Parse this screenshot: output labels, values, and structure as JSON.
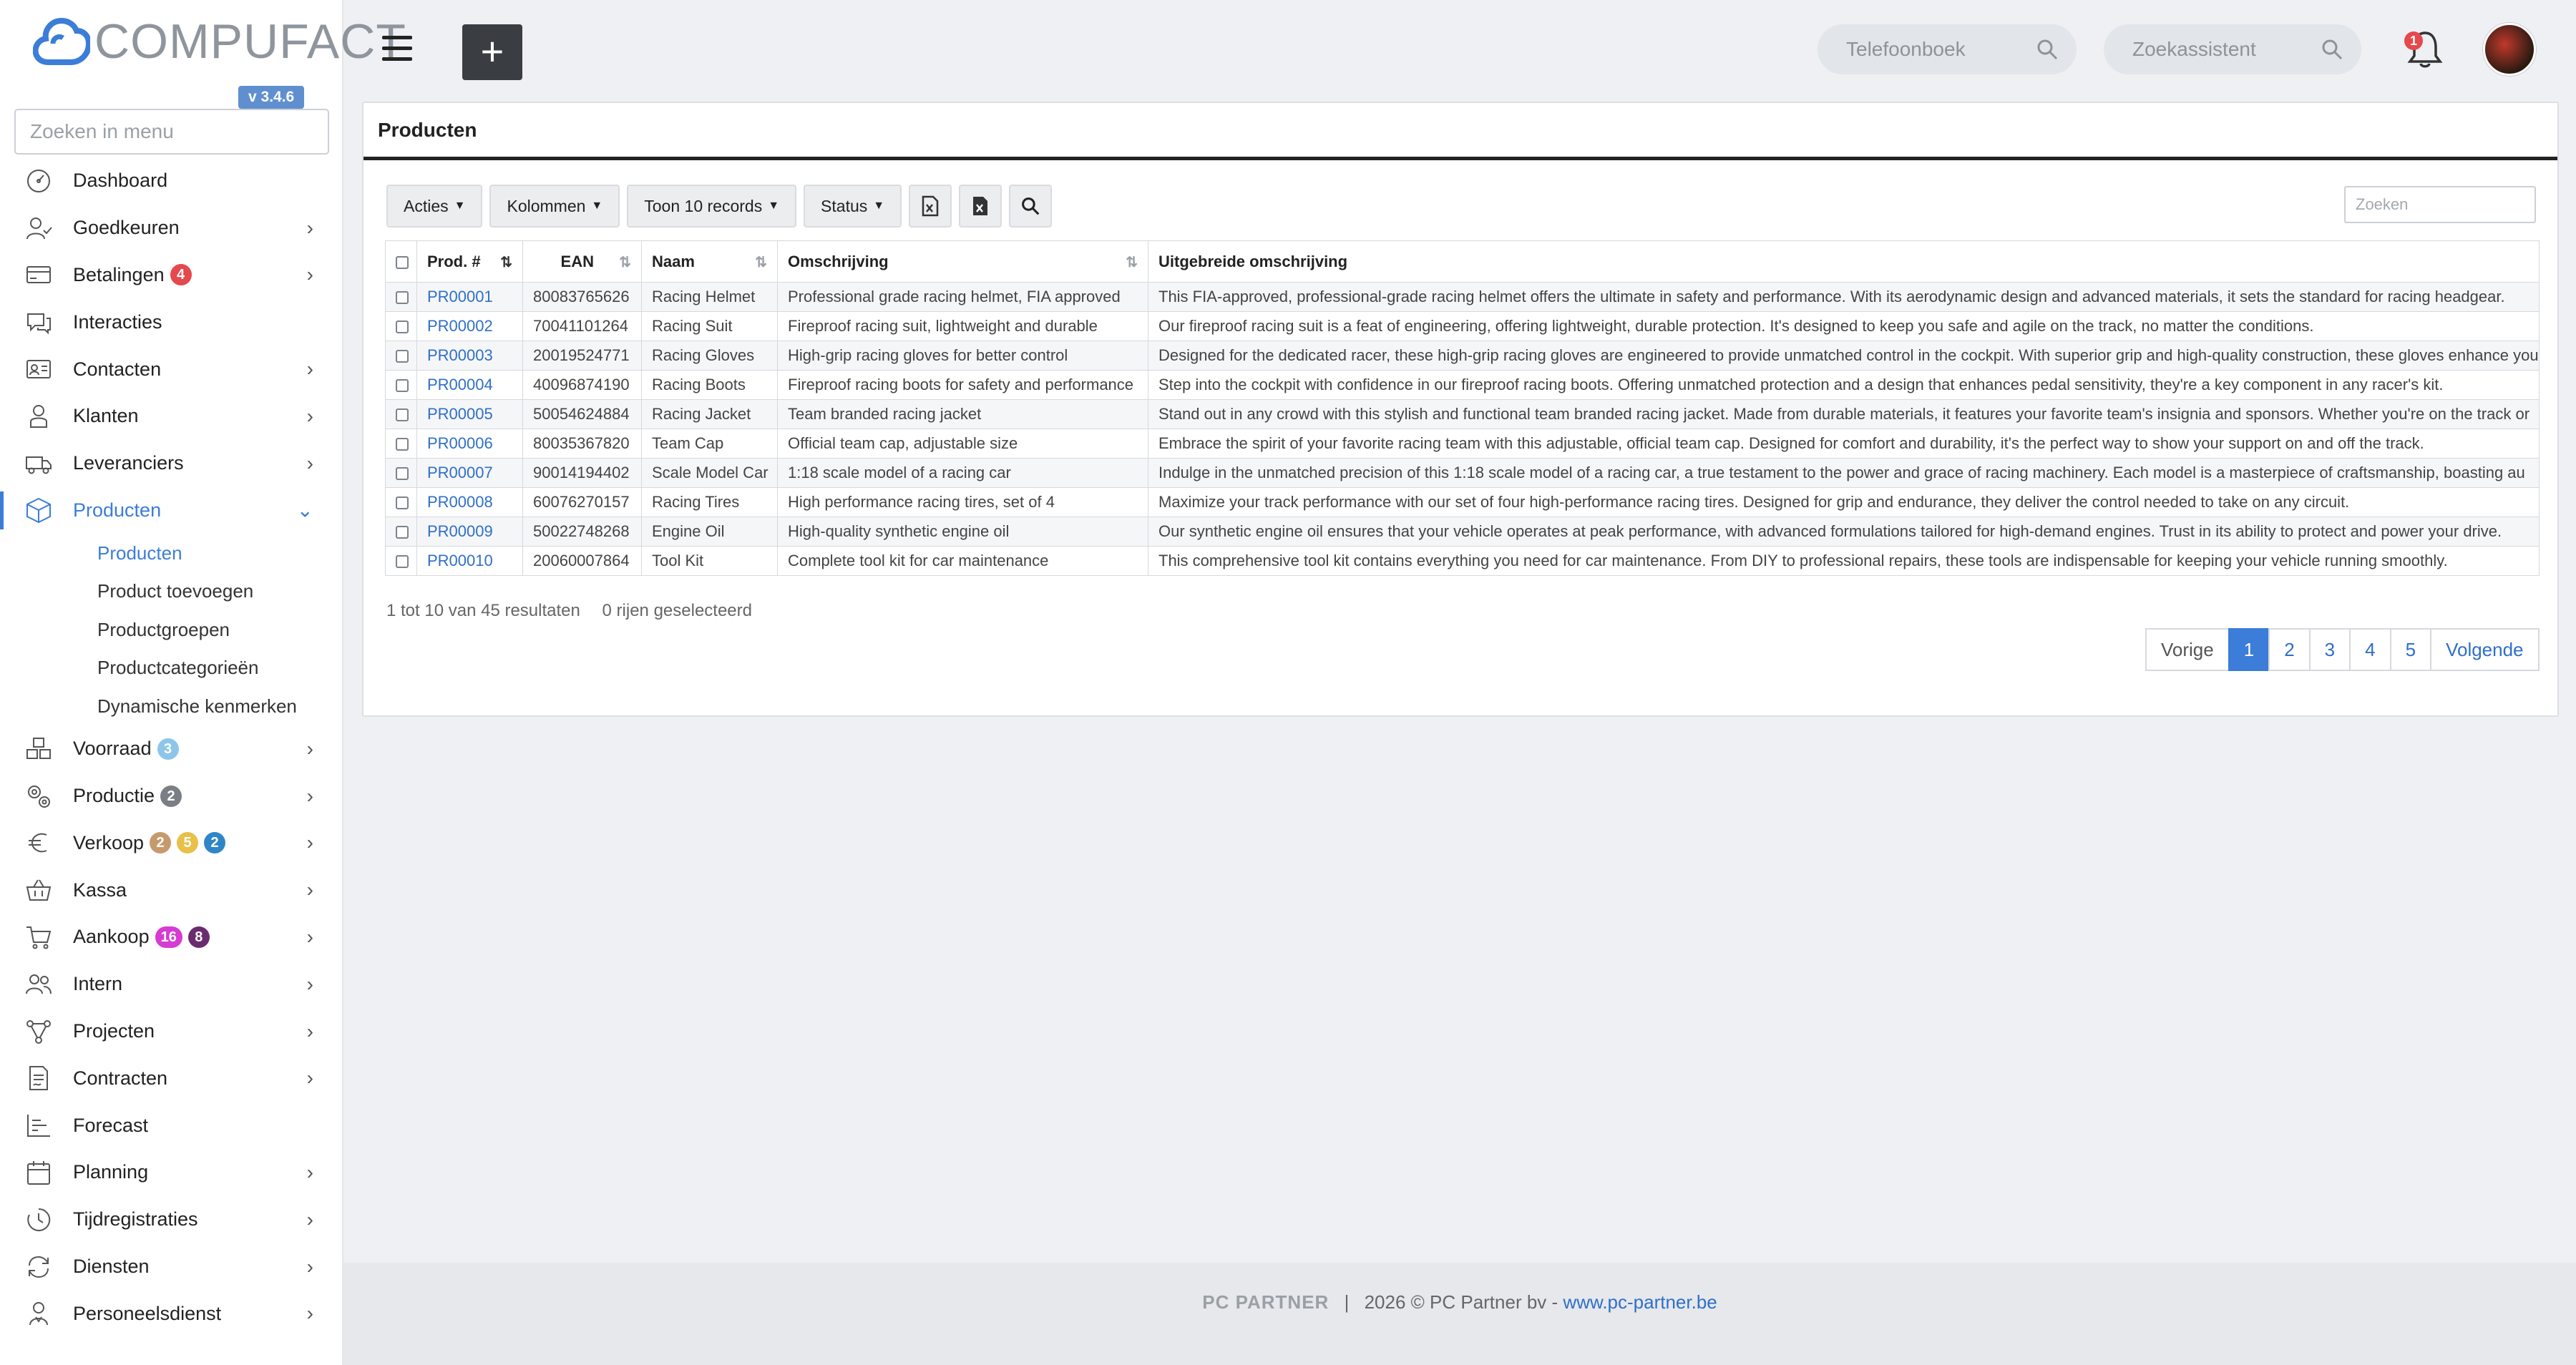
{
  "app": {
    "logo_text": "COMPUFACT",
    "version": "v 3.4.6",
    "menu_search_placeholder": "Zoeken in menu"
  },
  "sidebar": {
    "items": [
      {
        "label": "Dashboard",
        "icon": "dashboard-icon",
        "chevron": false
      },
      {
        "label": "Goedkeuren",
        "icon": "user-check-icon",
        "chevron": true
      },
      {
        "label": "Betalingen",
        "icon": "credit-card-icon",
        "chevron": true,
        "badges": [
          {
            "text": "4",
            "color": "#e5484d"
          }
        ]
      },
      {
        "label": "Interacties",
        "icon": "chat-icon",
        "chevron": false
      },
      {
        "label": "Contacten",
        "icon": "contact-card-icon",
        "chevron": true
      },
      {
        "label": "Klanten",
        "icon": "person-icon",
        "chevron": true
      },
      {
        "label": "Leveranciers",
        "icon": "truck-icon",
        "chevron": true
      },
      {
        "label": "Producten",
        "icon": "box-icon",
        "chevron": true,
        "active": true
      }
    ],
    "sub_items": [
      {
        "label": "Producten",
        "active": true
      },
      {
        "label": "Product toevoegen"
      },
      {
        "label": "Productgroepen"
      },
      {
        "label": "Productcategorieën"
      },
      {
        "label": "Dynamische kenmerken"
      }
    ],
    "items_after": [
      {
        "label": "Voorraad",
        "icon": "boxes-icon",
        "chevron": true,
        "badges": [
          {
            "text": "3",
            "color": "#8ec6ea"
          }
        ]
      },
      {
        "label": "Productie",
        "icon": "gears-icon",
        "chevron": true,
        "badges": [
          {
            "text": "2",
            "color": "#7a7f85"
          }
        ]
      },
      {
        "label": "Verkoop",
        "icon": "euro-icon",
        "chevron": true,
        "badges": [
          {
            "text": "2",
            "color": "#c59a6d"
          },
          {
            "text": "5",
            "color": "#e8c04a"
          },
          {
            "text": "2",
            "color": "#2f86c6"
          }
        ]
      },
      {
        "label": "Kassa",
        "icon": "basket-icon",
        "chevron": true
      },
      {
        "label": "Aankoop",
        "icon": "cart-icon",
        "chevron": true,
        "badges": [
          {
            "text": "16",
            "color": "#d63bd3"
          },
          {
            "text": "8",
            "color": "#6b2b6f"
          }
        ]
      },
      {
        "label": "Intern",
        "icon": "users-icon",
        "chevron": true
      },
      {
        "label": "Projecten",
        "icon": "project-icon",
        "chevron": true
      },
      {
        "label": "Contracten",
        "icon": "contract-icon",
        "chevron": true
      },
      {
        "label": "Forecast",
        "icon": "chart-icon",
        "chevron": false
      },
      {
        "label": "Planning",
        "icon": "calendar-icon",
        "chevron": true
      },
      {
        "label": "Tijdregistraties",
        "icon": "clock-icon",
        "chevron": true
      },
      {
        "label": "Diensten",
        "icon": "refresh-icon",
        "chevron": true
      },
      {
        "label": "Personeelsdienst",
        "icon": "staff-icon",
        "chevron": true
      }
    ]
  },
  "topbar": {
    "phonebook_placeholder": "Telefoonboek",
    "search_assistant_placeholder": "Zoekassistent",
    "notification_count": "1"
  },
  "page": {
    "title": "Producten",
    "toolbar": {
      "actions": "Acties",
      "columns": "Kolommen",
      "show_records": "Toon 10 records",
      "status": "Status"
    },
    "search_placeholder": "Zoeken",
    "columns": [
      "Prod. #",
      "EAN",
      "Naam",
      "Omschrijving",
      "Uitgebreide omschrijving"
    ],
    "rows": [
      {
        "id": "PR00001",
        "ean": "80083765626",
        "name": "Racing Helmet",
        "desc": "Professional grade racing helmet, FIA approved",
        "long": "This FIA-approved, professional-grade racing helmet offers the ultimate in safety and performance. With its aerodynamic design and advanced materials, it sets the standard for racing headgear."
      },
      {
        "id": "PR00002",
        "ean": "70041101264",
        "name": "Racing Suit",
        "desc": "Fireproof racing suit, lightweight and durable",
        "long": "Our fireproof racing suit is a feat of engineering, offering lightweight, durable protection. It's designed to keep you safe and agile on the track, no matter the conditions."
      },
      {
        "id": "PR00003",
        "ean": "20019524771",
        "name": "Racing Gloves",
        "desc": "High-grip racing gloves for better control",
        "long": "Designed for the dedicated racer, these high-grip racing gloves are engineered to provide unmatched control in the cockpit. With superior grip and high-quality construction, these gloves enhance your"
      },
      {
        "id": "PR00004",
        "ean": "40096874190",
        "name": "Racing Boots",
        "desc": "Fireproof racing boots for safety and performance",
        "long": "Step into the cockpit with confidence in our fireproof racing boots. Offering unmatched protection and a design that enhances pedal sensitivity, they're a key component in any racer's kit."
      },
      {
        "id": "PR00005",
        "ean": "50054624884",
        "name": "Racing Jacket",
        "desc": "Team branded racing jacket",
        "long": "Stand out in any crowd with this stylish and functional team branded racing jacket. Made from durable materials, it features your favorite team's insignia and sponsors. Whether you're on the track or"
      },
      {
        "id": "PR00006",
        "ean": "80035367820",
        "name": "Team Cap",
        "desc": "Official team cap, adjustable size",
        "long": "Embrace the spirit of your favorite racing team with this adjustable, official team cap. Designed for comfort and durability, it's the perfect way to show your support on and off the track."
      },
      {
        "id": "PR00007",
        "ean": "90014194402",
        "name": "Scale Model Car",
        "desc": "1:18 scale model of a racing car",
        "long": "Indulge in the unmatched precision of this 1:18 scale model of a racing car, a true testament to the power and grace of racing machinery. Each model is a masterpiece of craftsmanship, boasting au"
      },
      {
        "id": "PR00008",
        "ean": "60076270157",
        "name": "Racing Tires",
        "desc": "High performance racing tires, set of 4",
        "long": "Maximize your track performance with our set of four high-performance racing tires. Designed for grip and endurance, they deliver the control needed to take on any circuit."
      },
      {
        "id": "PR00009",
        "ean": "50022748268",
        "name": "Engine Oil",
        "desc": "High-quality synthetic engine oil",
        "long": "Our synthetic engine oil ensures that your vehicle operates at peak performance, with advanced formulations tailored for high-demand engines. Trust in its ability to protect and power your drive."
      },
      {
        "id": "PR00010",
        "ean": "20060007864",
        "name": "Tool Kit",
        "desc": "Complete tool kit for car maintenance",
        "long": "This comprehensive tool kit contains everything you need for car maintenance. From DIY to professional repairs, these tools are indispensable for keeping your vehicle running smoothly."
      }
    ],
    "info": "1 tot 10 van 45 resultaten",
    "selected_info": "0 rijen geselecteerd",
    "pagination": {
      "prev": "Vorige",
      "pages": [
        "1",
        "2",
        "3",
        "4",
        "5"
      ],
      "active": "1",
      "next": "Volgende"
    }
  },
  "footer": {
    "brand": "PC PARTNER",
    "copyright": "2026 © PC Partner bv -",
    "link": "www.pc-partner.be"
  }
}
